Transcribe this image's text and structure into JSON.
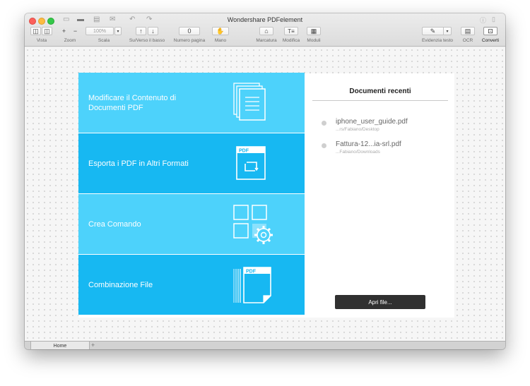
{
  "window": {
    "title": "Wondershare PDFelement"
  },
  "toolbar": {
    "zoom_value": "100%",
    "page_number": "0",
    "labels": {
      "vista": "Vista",
      "zoom": "Zoom",
      "scala": "Scala",
      "su_verso": "Su/Verso il basso",
      "numero_pagina": "Numero pagina",
      "mano": "Mano",
      "marcatura": "Marcatura",
      "modifica": "Modifica",
      "moduli": "Moduli",
      "evidenzia": "Evidenzia testo",
      "ocr": "OCR",
      "converti": "Converti"
    }
  },
  "tiles": [
    {
      "label_line1": "Modificare il Contenuto di",
      "label_line2": "Documenti PDF",
      "color": "#4dd2fb",
      "icon": "document-pages-icon"
    },
    {
      "label_line1": "Esporta i PDF in Altri Formati",
      "label_line2": "",
      "color": "#17b8f2",
      "icon": "pdf-convert-icon",
      "icon_text": "PDF"
    },
    {
      "label_line1": "Crea Comando",
      "label_line2": "",
      "color": "#4dd2fb",
      "icon": "grid-gear-icon"
    },
    {
      "label_line1": "Combinazione File",
      "label_line2": "",
      "color": "#17b8f2",
      "icon": "pdf-combine-icon",
      "icon_text": "PDF"
    }
  ],
  "recent": {
    "title": "Documenti recenti",
    "items": [
      {
        "name": "iphone_user_guide.pdf",
        "path": "...rs/Fabiano/Desktop"
      },
      {
        "name": "Fattura-12...ia-srl.pdf",
        "path": "...Fabiano/Downloads"
      }
    ],
    "open_button": "Apri file..."
  },
  "tabs": {
    "home": "Home",
    "add": "+"
  }
}
